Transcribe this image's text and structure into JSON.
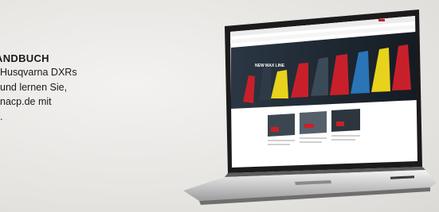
{
  "text_block": {
    "heading": "ANDBUCH",
    "lines": [
      "Husqvarna DXRs",
      "und lernen Sie,",
      "nacp.de mit",
      "."
    ]
  },
  "screen": {
    "hero_text": "NEW MAX LINE",
    "colors": {
      "page_bg": "#ffffff",
      "hero_dark": "#1c2530",
      "accent_red": "#c8202a",
      "accent_yellow": "#e8d21c",
      "accent_blue": "#2a74b8"
    }
  },
  "icons": {
    "laptop": "laptop-illustration"
  }
}
